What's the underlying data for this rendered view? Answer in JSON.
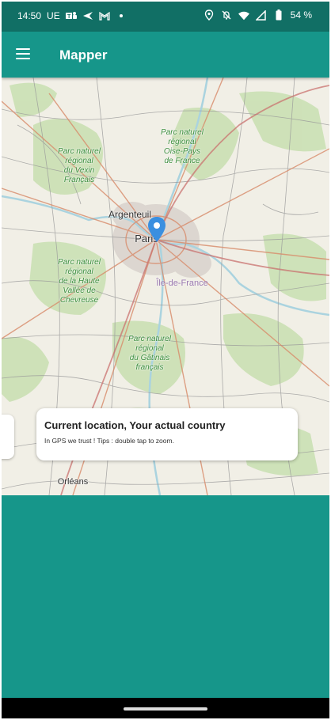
{
  "status_bar": {
    "time": "14:50",
    "carrier": "UE",
    "notification_icons": [
      "teams-icon",
      "send-icon",
      "gmail-icon",
      "dot-icon"
    ],
    "system_icons": [
      "location-icon",
      "alarm-off-icon",
      "wifi-icon",
      "signal-icon",
      "battery-icon"
    ],
    "battery": "54 %"
  },
  "app_bar": {
    "title": "Mapper",
    "menu_icon": "hamburger-menu-icon"
  },
  "map": {
    "marker_icon": "map-pin-icon",
    "labels": {
      "vexin": "Parc naturel\nrégional\ndu Vexin\nFrançais",
      "oise": "Parc naturel\nrégional\nOise-Pays\nde France",
      "chevreuse": "Parc naturel\nrégional\nde la Haute\nVallée de\nChevreuse",
      "gatinais": "Parc naturel\nrégional\ndu Gâtinais\nfrançais",
      "argenteuil": "Argenteuil",
      "paris": "Paris",
      "idf": "Île-de-France",
      "orleans": "Orléans"
    }
  },
  "popup": {
    "title": "Current location, Your actual country",
    "subtitle": "In GPS we trust ! Tips : double tap to zoom."
  },
  "colors": {
    "primary": "#16968a",
    "status_bar": "#116f65",
    "marker": "#3a8fe0"
  }
}
